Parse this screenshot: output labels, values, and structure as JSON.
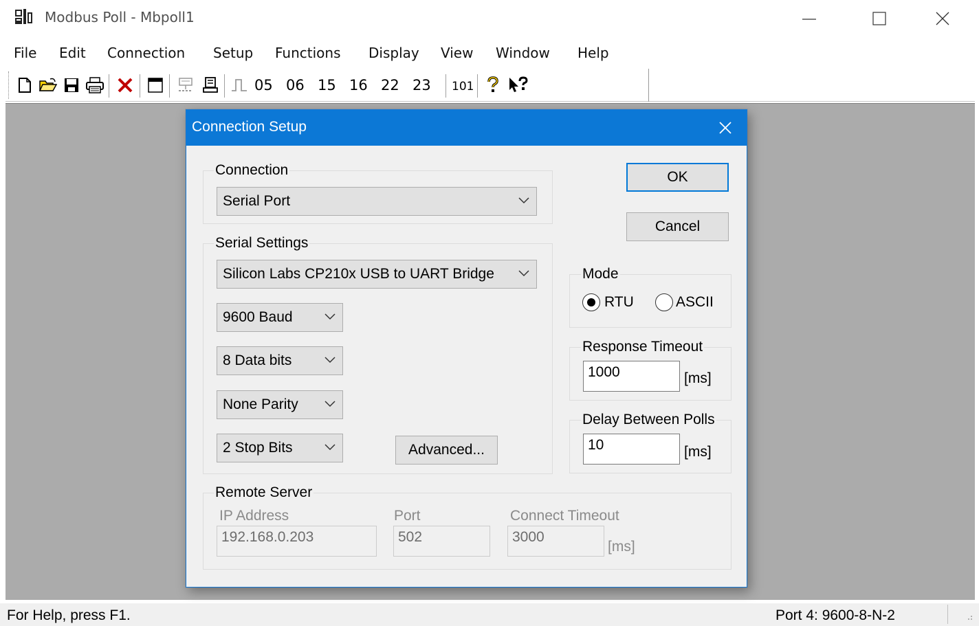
{
  "window": {
    "title": "Modbus Poll - Mbpoll1"
  },
  "menu": [
    "File",
    "Edit",
    "Connection",
    "Setup",
    "Functions",
    "Display",
    "View",
    "Window",
    "Help"
  ],
  "toolbar": {
    "function_codes": [
      "05",
      "06",
      "15",
      "16",
      "22",
      "23"
    ],
    "count_label": "101"
  },
  "status": {
    "help_text": "For Help, press F1.",
    "port_text": "Port 4: 9600-8-N-2"
  },
  "dialog": {
    "title": "Connection Setup",
    "connection": {
      "label": "Connection",
      "value": "Serial Port"
    },
    "serial_settings": {
      "label": "Serial Settings",
      "port": "Silicon Labs CP210x USB to UART Bridge",
      "baud": "9600 Baud",
      "data_bits": "8 Data bits",
      "parity": "None Parity",
      "stop_bits": "2 Stop Bits",
      "advanced_label": "Advanced..."
    },
    "buttons": {
      "ok": "OK",
      "cancel": "Cancel"
    },
    "mode": {
      "label": "Mode",
      "options": [
        "RTU",
        "ASCII"
      ],
      "selected": "RTU"
    },
    "response_timeout": {
      "label": "Response Timeout",
      "value": "1000",
      "unit": "[ms]"
    },
    "delay_between_polls": {
      "label": "Delay Between Polls",
      "value": "10",
      "unit": "[ms]"
    },
    "remote_server": {
      "label": "Remote Server",
      "ip_label": "IP Address",
      "ip_value": "192.168.0.203",
      "port_label": "Port",
      "port_value": "502",
      "timeout_label": "Connect Timeout",
      "timeout_value": "3000",
      "timeout_unit": "[ms]"
    }
  },
  "colors": {
    "dialog_titlebar": "#0c78d6",
    "mdi_background": "#ababab",
    "default_button_border": "#0078d7"
  }
}
